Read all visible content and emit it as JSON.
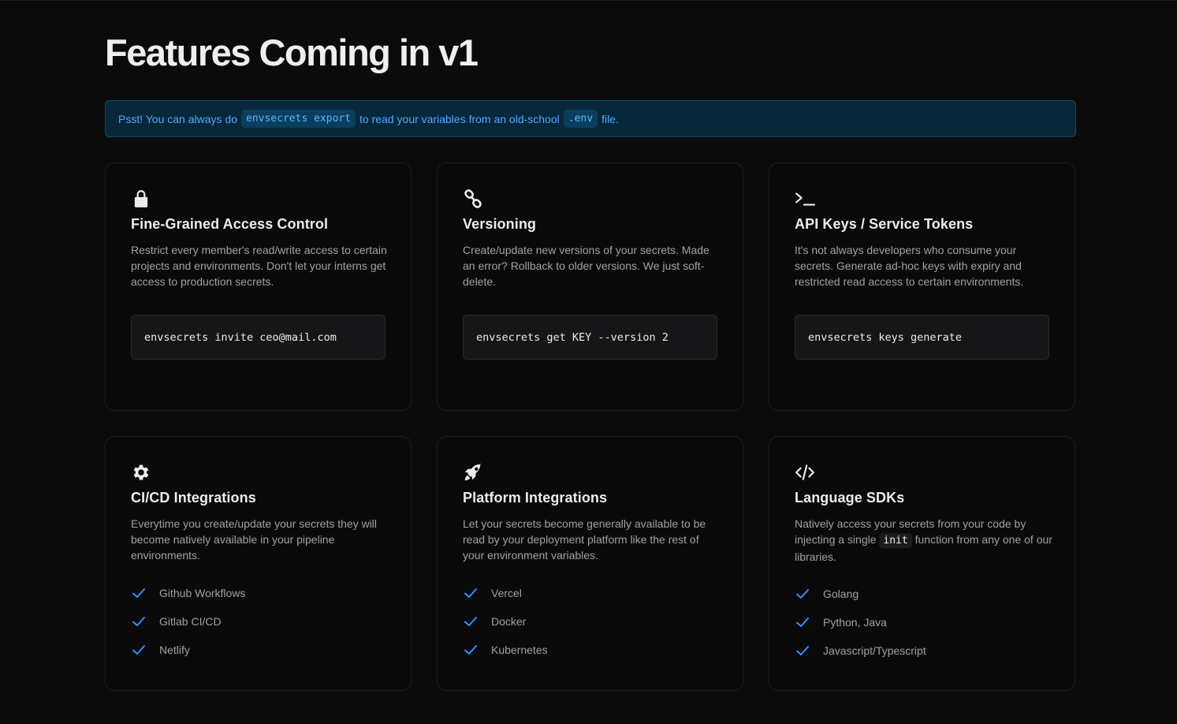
{
  "page": {
    "title": "Features Coming in v1"
  },
  "banner": {
    "prefix": "Psst! You can always do",
    "command": "envsecrets export",
    "middle": "to read your variables from an old-school",
    "file": ".env",
    "suffix": "file."
  },
  "cards": [
    {
      "icon": "lock-icon",
      "title": "Fine-Grained Access Control",
      "description": "Restrict every member's read/write access to certain projects and environments. Don't let your interns get access to production secrets.",
      "command": "envsecrets invite ceo@mail.com"
    },
    {
      "icon": "link-icon",
      "title": "Versioning",
      "description": "Create/update new versions of your secrets. Made an error? Rollback to older versions. We just soft-delete.",
      "command": "envsecrets get KEY --version 2"
    },
    {
      "icon": "terminal-icon",
      "title": "API Keys / Service Tokens",
      "description": "It's not always developers who consume your secrets. Generate ad-hoc keys with expiry and restricted read access to certain environments.",
      "command": "envsecrets keys generate"
    },
    {
      "icon": "gear-icon",
      "title": "CI/CD Integrations",
      "description": "Everytime you create/update your secrets they will become natively available in your pipeline environments.",
      "items": [
        "Github Workflows",
        "Gitlab CI/CD",
        "Netlify"
      ]
    },
    {
      "icon": "rocket-icon",
      "title": "Platform Integrations",
      "description": "Let your secrets become generally available to be read by your deployment platform like the rest of your environment variables.",
      "items": [
        "Vercel",
        "Docker",
        "Kubernetes"
      ]
    },
    {
      "icon": "code-icon",
      "title": "Language SDKs",
      "description_prefix": "Natively access your secrets from your code by injecting a single",
      "description_code": "init",
      "description_suffix": "function from any one of our libraries.",
      "items": [
        "Golang",
        "Python, Java",
        "Javascript/Typescript"
      ]
    }
  ],
  "colors": {
    "background": "#0b0b0c",
    "accent": "#3291ff",
    "banner_bg": "#06283a",
    "banner_text": "#52a8ff"
  }
}
